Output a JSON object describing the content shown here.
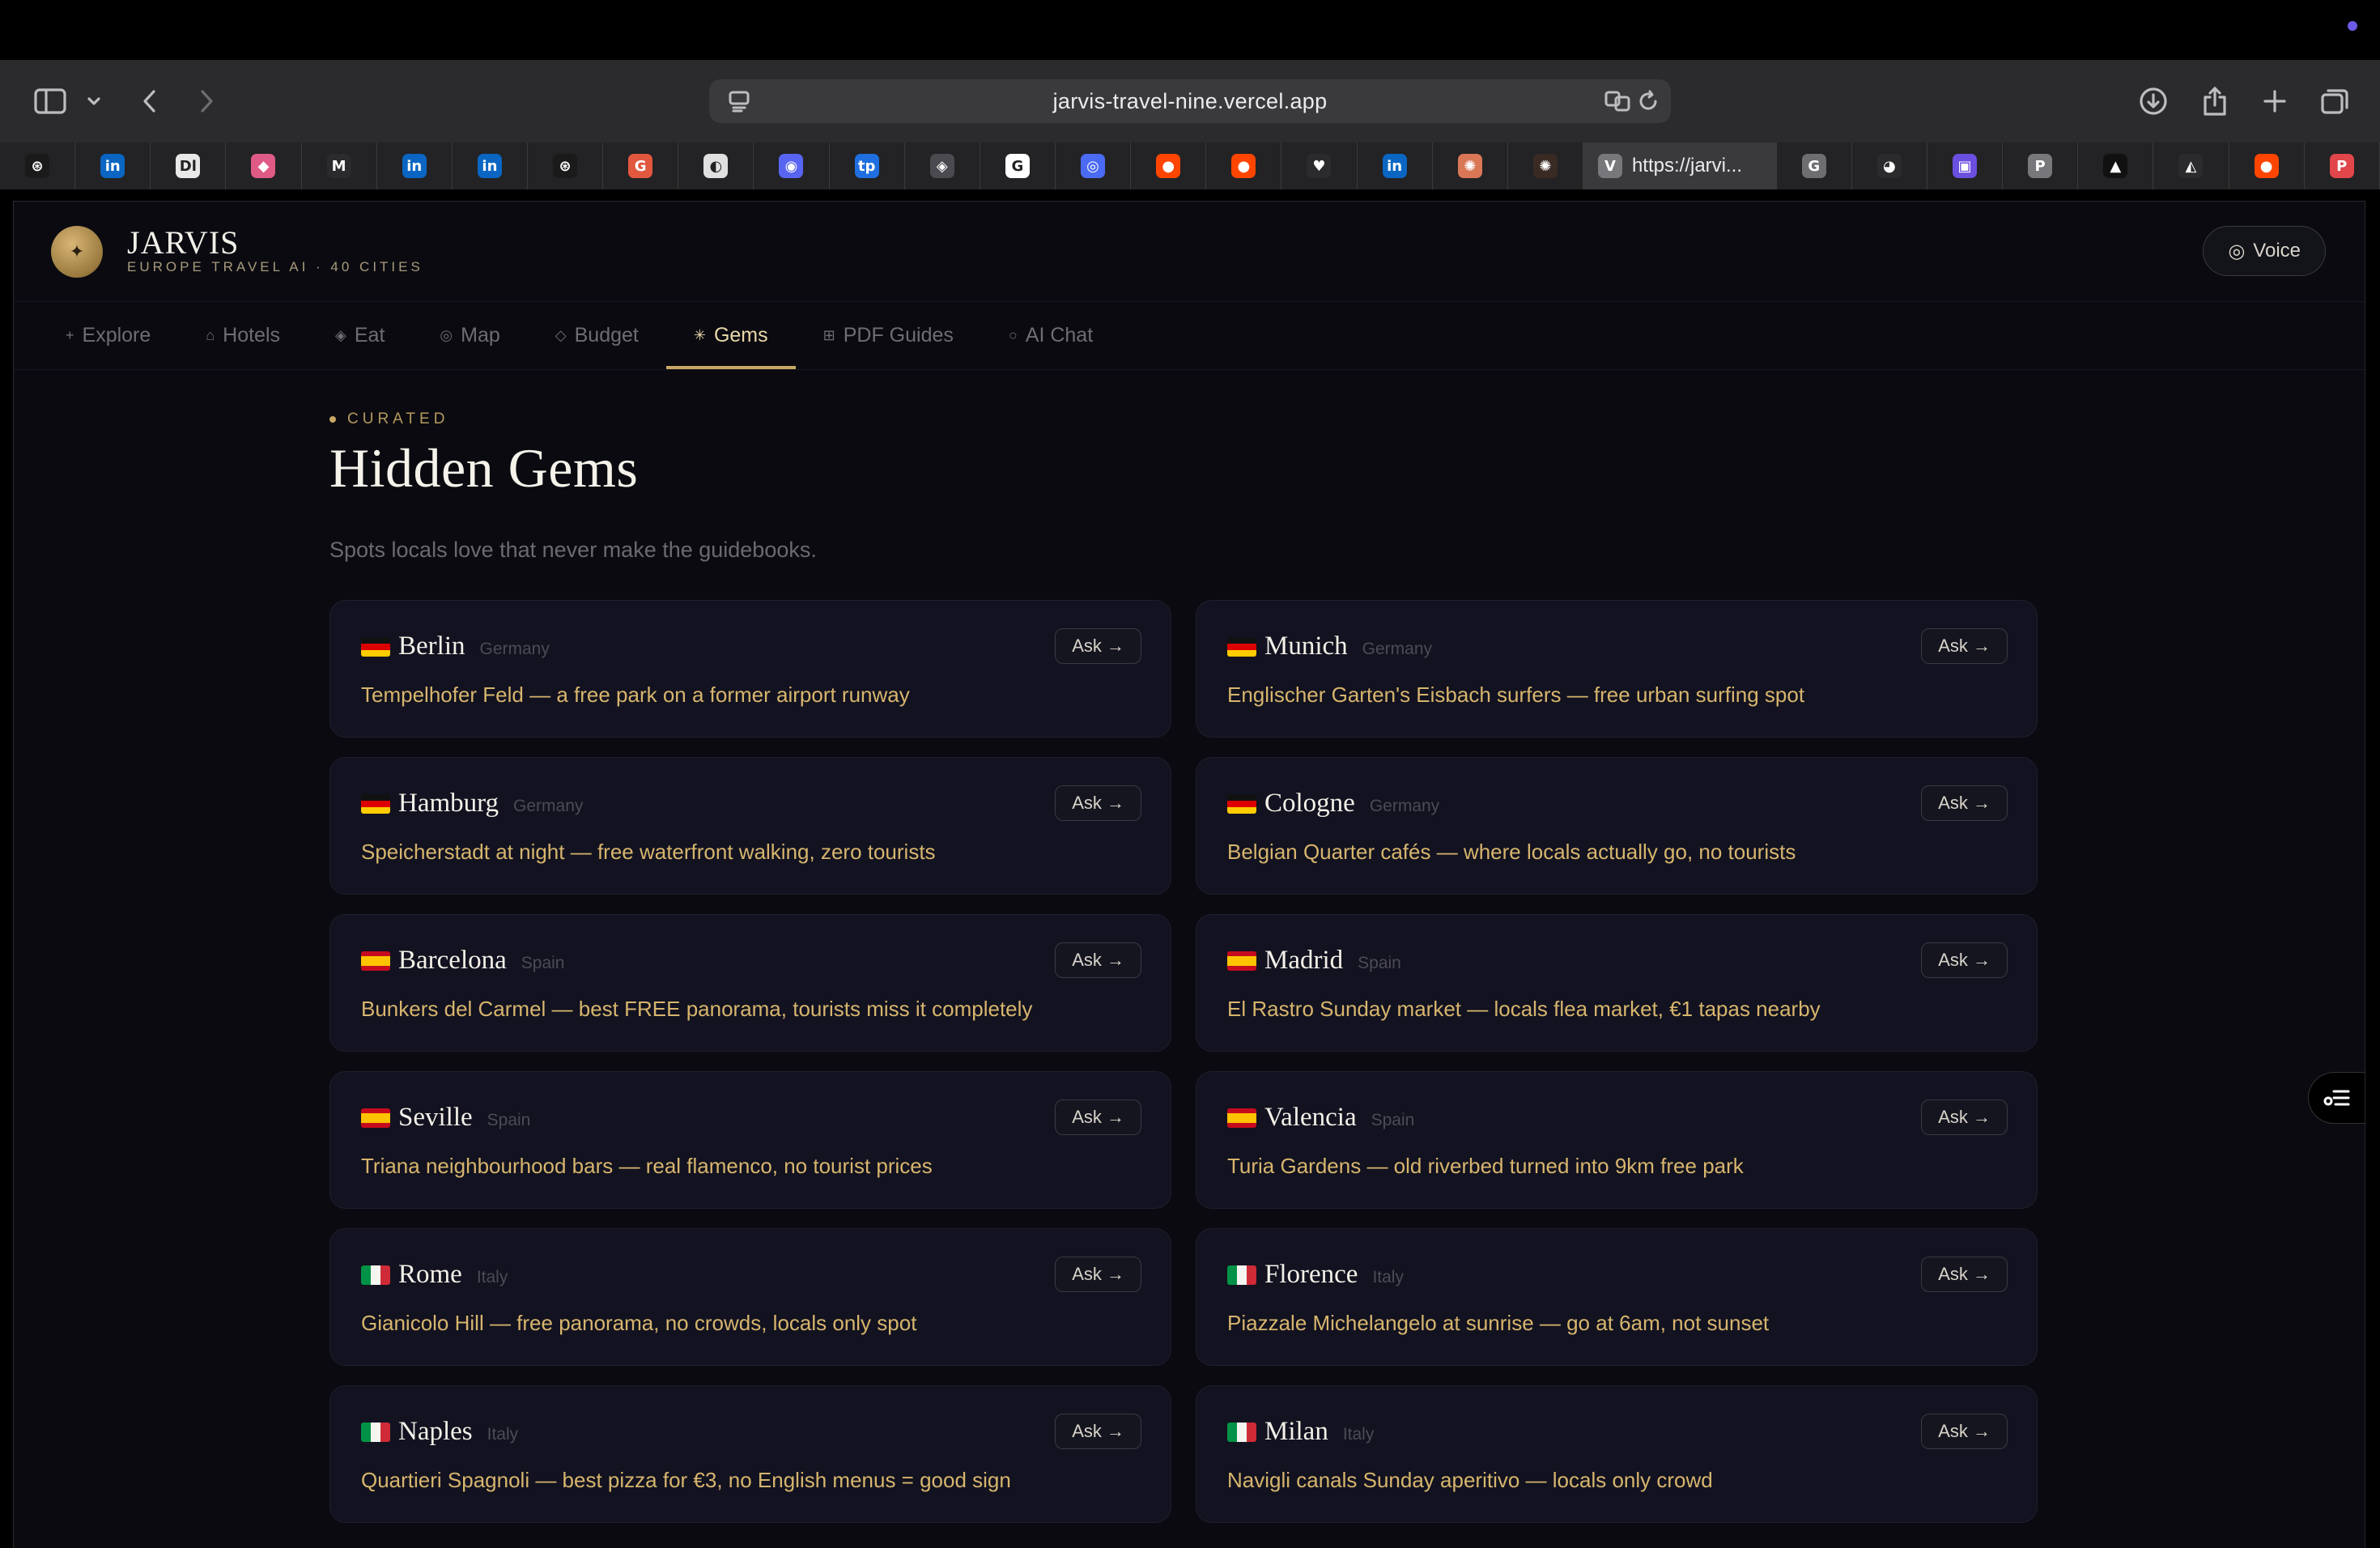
{
  "browser": {
    "url": "jarvis-travel-nine.vercel.app",
    "active_tab_title": "https://jarvi...",
    "tabs": [
      {
        "icon": "openai-icon",
        "letter": "⊛",
        "color": "#1a1a1a"
      },
      {
        "icon": "linkedin-icon",
        "letter": "in",
        "color": "#0a66c2"
      },
      {
        "icon": "dl-icon",
        "letter": "Dl",
        "color": "#e8e8e8"
      },
      {
        "icon": "pink-app-icon",
        "letter": "◆",
        "color": "#e05a86"
      },
      {
        "icon": "gmail-icon",
        "letter": "M",
        "color": "#2b2b2d"
      },
      {
        "icon": "linkedin-icon",
        "letter": "in",
        "color": "#0a66c2"
      },
      {
        "icon": "linkedin-icon",
        "letter": "in",
        "color": "#0a66c2"
      },
      {
        "icon": "openai-icon",
        "letter": "⊛",
        "color": "#1a1a1a"
      },
      {
        "icon": "g-app-icon",
        "letter": "G",
        "color": "#e2583e"
      },
      {
        "icon": "clock-app-icon",
        "letter": "◐",
        "color": "#e0e0e0"
      },
      {
        "icon": "discord-icon",
        "letter": "◉",
        "color": "#5865f2"
      },
      {
        "icon": "tp-app-icon",
        "letter": "tp",
        "color": "#1f6fe0"
      },
      {
        "icon": "cube-icon",
        "letter": "◈",
        "color": "#4a4a50"
      },
      {
        "icon": "google-icon",
        "letter": "G",
        "color": "#ffffff"
      },
      {
        "icon": "chat-app-icon",
        "letter": "◎",
        "color": "#4b6bf5"
      },
      {
        "icon": "reddit-icon",
        "letter": "●",
        "color": "#ff4500"
      },
      {
        "icon": "reddit-icon",
        "letter": "●",
        "color": "#ff4500"
      },
      {
        "icon": "heart-icon",
        "letter": "♥",
        "color": "#2b2b2d"
      },
      {
        "icon": "linkedin-icon",
        "letter": "in",
        "color": "#0a66c2"
      },
      {
        "icon": "claude-icon",
        "letter": "✺",
        "color": "#d97757"
      },
      {
        "icon": "claude-icon",
        "letter": "✺",
        "color": "#3a2a24"
      }
    ],
    "tabs_after": [
      {
        "icon": "g-gray-icon",
        "letter": "G",
        "color": "#6e6e72"
      },
      {
        "icon": "github-icon",
        "letter": "◕",
        "color": "#2b2b2d"
      },
      {
        "icon": "purple-app-icon",
        "letter": "▣",
        "color": "#6b4fe0"
      },
      {
        "icon": "p-gray-icon",
        "letter": "P",
        "color": "#77777c"
      },
      {
        "icon": "vercel-icon",
        "letter": "▲",
        "color": "#111111"
      },
      {
        "icon": "drive-icon",
        "letter": "◭",
        "color": "#2b2b2d"
      },
      {
        "icon": "reddit-icon",
        "letter": "●",
        "color": "#ff4500"
      },
      {
        "icon": "p-red-icon",
        "letter": "P",
        "color": "#e0464a"
      }
    ]
  },
  "app": {
    "title": "JARVIS",
    "subtitle": "EUROPE TRAVEL AI · 40 CITIES",
    "voice_label": "Voice"
  },
  "nav": [
    {
      "icon": "+",
      "label": "Explore",
      "active": false
    },
    {
      "icon": "⌂",
      "label": "Hotels",
      "active": false
    },
    {
      "icon": "◈",
      "label": "Eat",
      "active": false
    },
    {
      "icon": "◎",
      "label": "Map",
      "active": false
    },
    {
      "icon": "◇",
      "label": "Budget",
      "active": false
    },
    {
      "icon": "✳",
      "label": "Gems",
      "active": true
    },
    {
      "icon": "⊞",
      "label": "PDF Guides",
      "active": false
    },
    {
      "icon": "○",
      "label": "AI Chat",
      "active": false
    }
  ],
  "section": {
    "eyebrow": "CURATED",
    "title": "Hidden Gems",
    "subtitle": "Spots locals love that never make the guidebooks."
  },
  "ask_label": "Ask →",
  "gems": [
    {
      "flag": "de",
      "city": "Berlin",
      "country": "Germany",
      "tip": "Tempelhofer Feld — a free park on a former airport runway"
    },
    {
      "flag": "de",
      "city": "Munich",
      "country": "Germany",
      "tip": "Englischer Garten's Eisbach surfers — free urban surfing spot"
    },
    {
      "flag": "de",
      "city": "Hamburg",
      "country": "Germany",
      "tip": "Speicherstadt at night — free waterfront walking, zero tourists"
    },
    {
      "flag": "de",
      "city": "Cologne",
      "country": "Germany",
      "tip": "Belgian Quarter cafés — where locals actually go, no tourists"
    },
    {
      "flag": "es",
      "city": "Barcelona",
      "country": "Spain",
      "tip": "Bunkers del Carmel — best FREE panorama, tourists miss it completely"
    },
    {
      "flag": "es",
      "city": "Madrid",
      "country": "Spain",
      "tip": "El Rastro Sunday market — locals flea market, €1 tapas nearby"
    },
    {
      "flag": "es",
      "city": "Seville",
      "country": "Spain",
      "tip": "Triana neighbourhood bars — real flamenco, no tourist prices"
    },
    {
      "flag": "es",
      "city": "Valencia",
      "country": "Spain",
      "tip": "Turia Gardens — old riverbed turned into 9km free park"
    },
    {
      "flag": "it",
      "city": "Rome",
      "country": "Italy",
      "tip": "Gianicolo Hill — free panorama, no crowds, locals only spot"
    },
    {
      "flag": "it",
      "city": "Florence",
      "country": "Italy",
      "tip": "Piazzale Michelangelo at sunrise — go at 6am, not sunset"
    },
    {
      "flag": "it",
      "city": "Naples",
      "country": "Italy",
      "tip": "Quartieri Spagnoli — best pizza for €3, no English menus = good sign"
    },
    {
      "flag": "it",
      "city": "Milan",
      "country": "Italy",
      "tip": "Navigli canals Sunday aperitivo — locals only crowd"
    }
  ]
}
